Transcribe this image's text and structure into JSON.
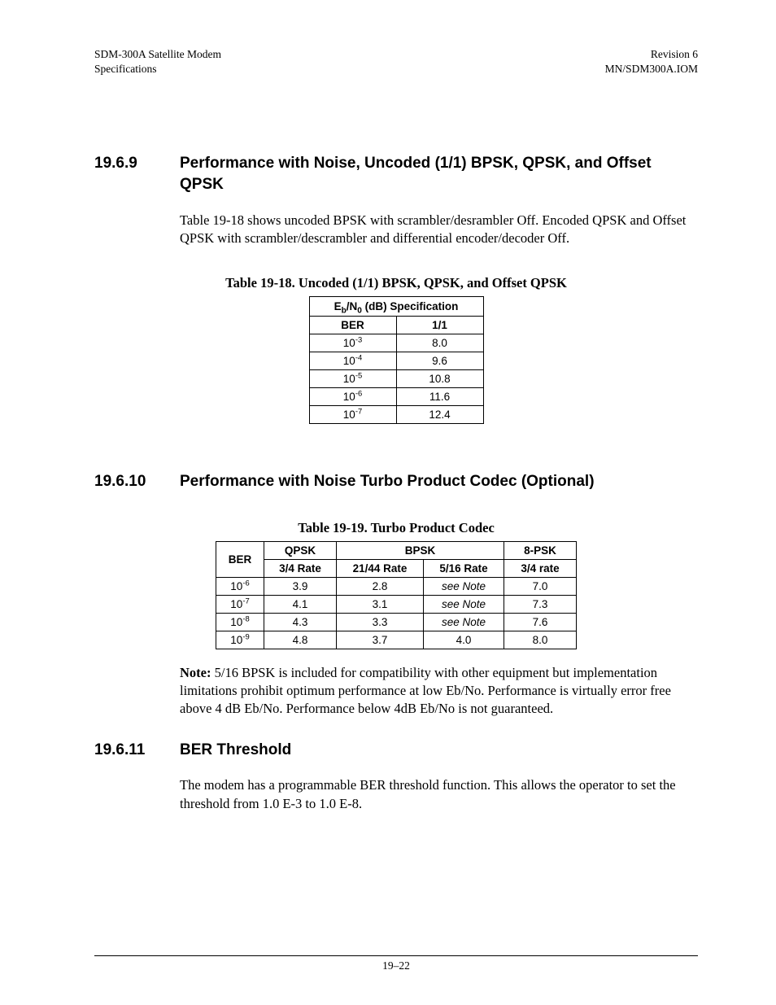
{
  "header": {
    "left_line1": "SDM-300A Satellite Modem",
    "left_line2": "Specifications",
    "right_line1": "Revision 6",
    "right_line2": "MN/SDM300A.IOM"
  },
  "section_1969": {
    "num": "19.6.9",
    "title": "Performance with Noise, Uncoded (1/1) BPSK, QPSK, and Offset QPSK",
    "intro": "Table 19-18 shows uncoded BPSK with scrambler/desrambler Off. Encoded QPSK and Offset QPSK with scrambler/descrambler and differential encoder/decoder Off."
  },
  "table18": {
    "caption": "Table 19-18.  Uncoded (1/1) BPSK, QPSK, and Offset QPSK",
    "spec_head_prefix": "E",
    "spec_head_sub1": "b",
    "spec_head_mid": "/N",
    "spec_head_sub2": "0",
    "spec_head_suffix": " (dB) Specification",
    "col_ber": "BER",
    "col_rate": "1/1",
    "rows": [
      {
        "exp": "-3",
        "val": "8.0"
      },
      {
        "exp": "-4",
        "val": "9.6"
      },
      {
        "exp": "-5",
        "val": "10.8"
      },
      {
        "exp": "-6",
        "val": "11.6"
      },
      {
        "exp": "-7",
        "val": "12.4"
      }
    ]
  },
  "section_19610": {
    "num": "19.6.10",
    "title": "Performance with Noise Turbo Product Codec (Optional)"
  },
  "table19": {
    "caption": "Table 19-19.  Turbo Product Codec",
    "head_qpsk": "QPSK",
    "head_bpsk": "BPSK",
    "head_8psk": "8-PSK",
    "sub_ber": "BER",
    "sub_qpsk": "3/4 Rate",
    "sub_b1": "21/44 Rate",
    "sub_b2": "5/16 Rate",
    "sub_8p": "3/4 rate",
    "see_note": "see Note",
    "rows": [
      {
        "exp": "-6",
        "qpsk": "3.9",
        "b1": "2.8",
        "b2_note": true,
        "b2": "",
        "p8": "7.0"
      },
      {
        "exp": "-7",
        "qpsk": "4.1",
        "b1": "3.1",
        "b2_note": true,
        "b2": "",
        "p8": "7.3"
      },
      {
        "exp": "-8",
        "qpsk": "4.3",
        "b1": "3.3",
        "b2_note": true,
        "b2": "",
        "p8": "7.6"
      },
      {
        "exp": "-9",
        "qpsk": "4.8",
        "b1": "3.7",
        "b2_note": false,
        "b2": "4.0",
        "p8": "8.0"
      }
    ],
    "note_label": "Note:",
    "note_text": " 5/16 BPSK is included for compatibility with other equipment but implementation limitations prohibit optimum performance at low Eb/No. Performance is virtually error free above 4 dB Eb/No. Performance below 4dB Eb/No is not guaranteed."
  },
  "section_19611": {
    "num": "19.6.11",
    "title": "BER Threshold",
    "body": "The modem has a programmable BER threshold function. This allows the operator to set the threshold from 1.0 E-3 to 1.0 E-8."
  },
  "footer": {
    "page": "19–22"
  },
  "ten": "10"
}
